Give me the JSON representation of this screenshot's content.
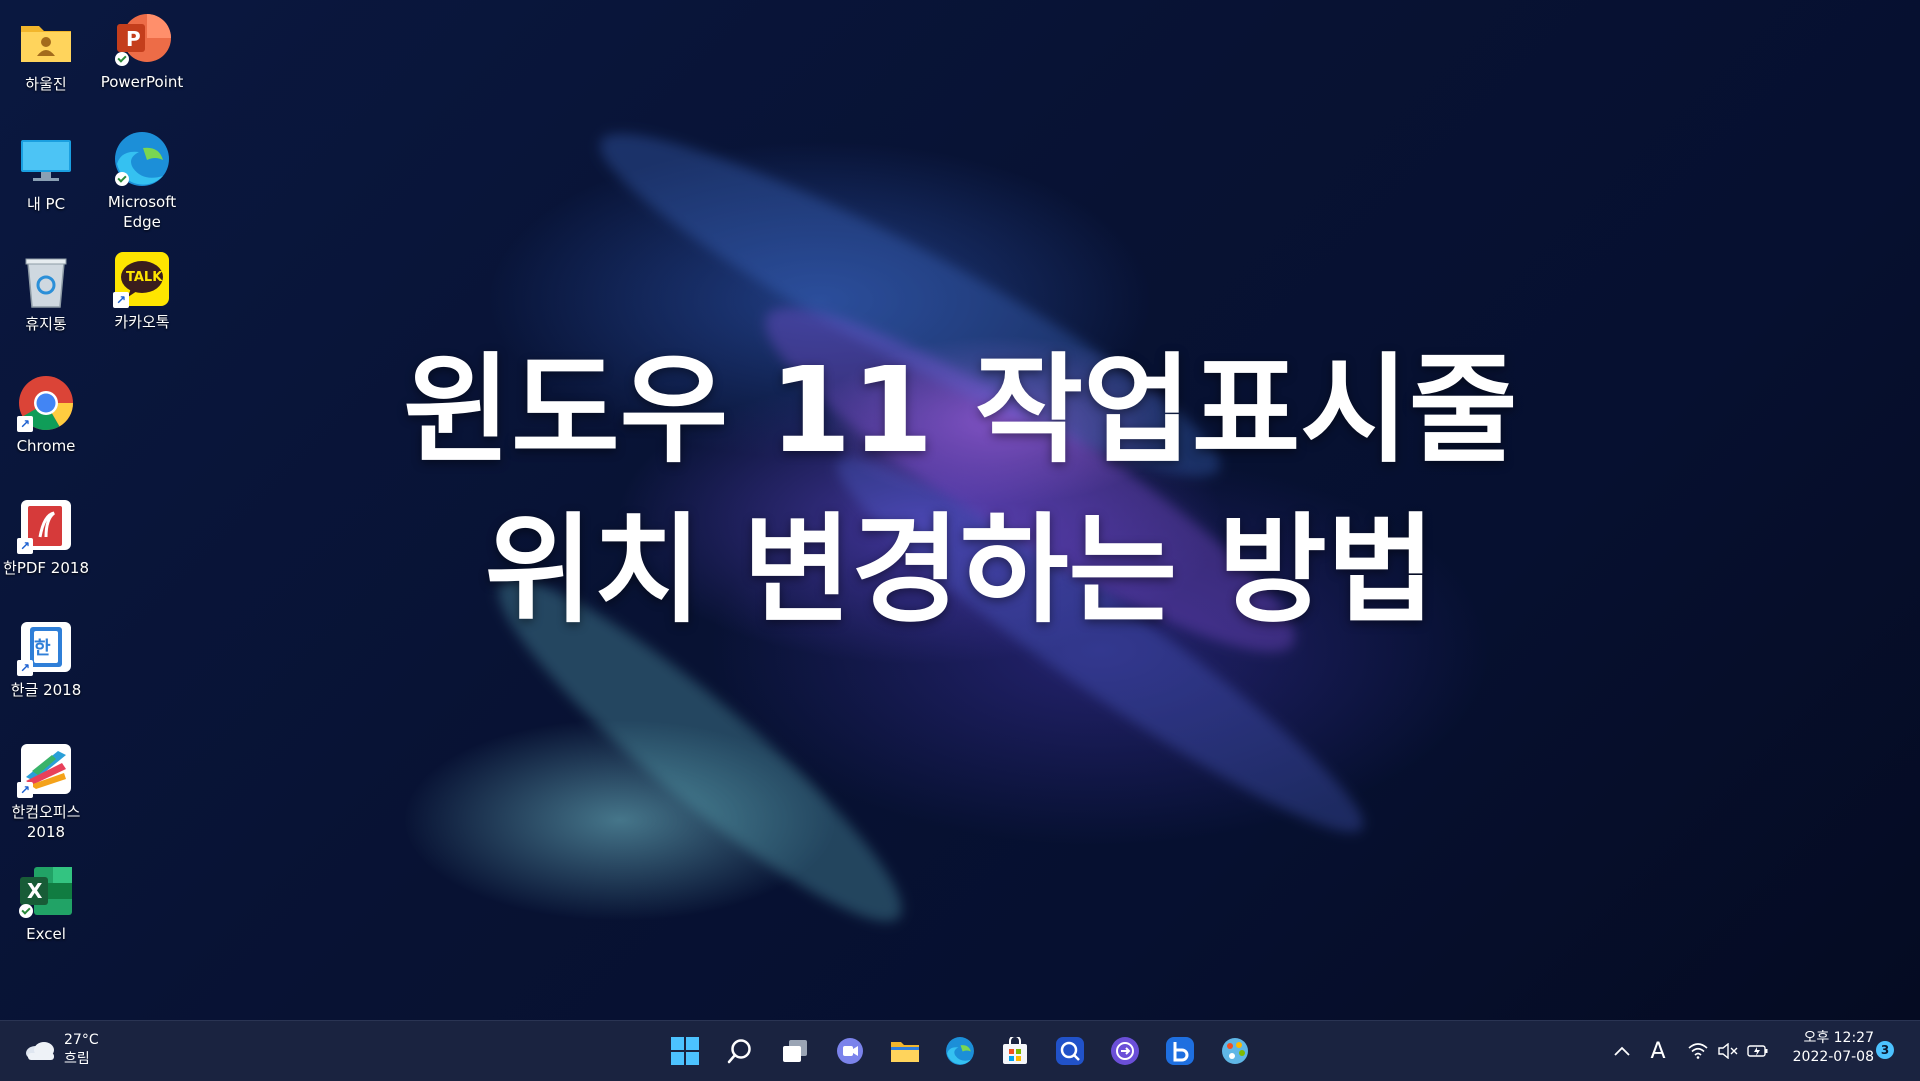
{
  "desktop_icons": [
    {
      "label": "하울진"
    },
    {
      "label": "PowerPoint"
    },
    {
      "label": "내 PC"
    },
    {
      "label": "Microsoft\nEdge"
    },
    {
      "label": "휴지통"
    },
    {
      "label": "카카오톡"
    },
    {
      "label": "Chrome"
    },
    {
      "label": "한PDF 2018"
    },
    {
      "label": "한글 2018"
    },
    {
      "label": "한컴오피스\n2018"
    },
    {
      "label": "Excel"
    }
  ],
  "icon_glyphs": {
    "powerpoint": "P",
    "kakaotalk": "TALK",
    "excel": "X",
    "hangul": "한"
  },
  "overlay": {
    "line1": "윈도우 11 작업표시줄",
    "line2": "위치 변경하는 방법"
  },
  "taskbar": {
    "weather": {
      "temp": "27°C",
      "condition": "흐림"
    },
    "apps": [
      "start-icon",
      "search-icon",
      "task-view-icon",
      "teams-chat-icon",
      "file-explorer-icon",
      "edge-icon",
      "store-icon",
      "app-icon-1",
      "app-icon-2",
      "app-icon-3",
      "app-icon-4"
    ],
    "tray": {
      "ime": "A",
      "time": "오후 12:27",
      "date": "2022-07-08",
      "notification_count": "3"
    }
  }
}
